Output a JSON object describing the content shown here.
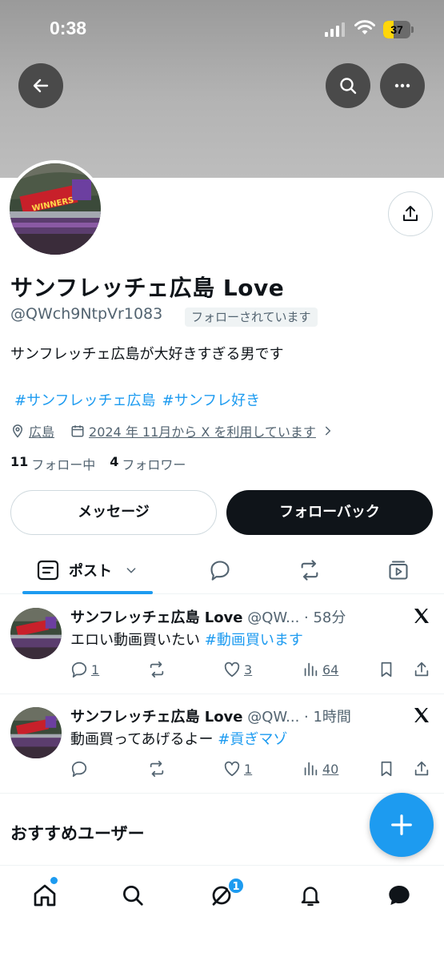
{
  "status_bar": {
    "time": "0:38",
    "battery_percent": "37",
    "battery_level": 0.37
  },
  "top_actions": {
    "back_icon": "arrow-left-icon",
    "search_icon": "search-icon",
    "more_icon": "more-horizontal-icon"
  },
  "profile": {
    "display_name": "サンフレッチェ広島 Love",
    "handle": "@QWch9NtpVr1083",
    "follows_you": "フォローされています",
    "bio": "サンフレッチェ広島が大好きすぎる男です",
    "hashtags": [
      "#サンフレッチェ広島",
      "#サンフレ好き"
    ],
    "location": "広島",
    "joined": "2024 年 11月から X を利用しています",
    "following_count": "11",
    "following_label": "フォロー中",
    "followers_count": "4",
    "followers_label": "フォロワー",
    "message_button": "メッセージ",
    "followback_button": "フォローバック"
  },
  "tabs": {
    "posts_label": "ポスト"
  },
  "tweets": [
    {
      "name": "サンフレッチェ広島 Love",
      "handle_time": "@QW... · 58分",
      "text": "エロい動画買いたい",
      "tag": "#動画買います",
      "replies": "1",
      "reposts": "",
      "likes": "3",
      "views": "64"
    },
    {
      "name": "サンフレッチェ広島 Love",
      "handle_time": "@QW... · 1時間",
      "text": "動画買ってあげるよー",
      "tag": "#貢ぎマゾ",
      "replies": "",
      "reposts": "",
      "likes": "1",
      "views": "40"
    }
  ],
  "suggestions": {
    "title": "おすすめユーザー"
  },
  "bottom_nav": {
    "grok_badge": "1"
  },
  "colors": {
    "accent": "#1d9bf0",
    "text_primary": "#0f1419",
    "text_secondary": "#536471",
    "battery": "#ffd60a"
  }
}
